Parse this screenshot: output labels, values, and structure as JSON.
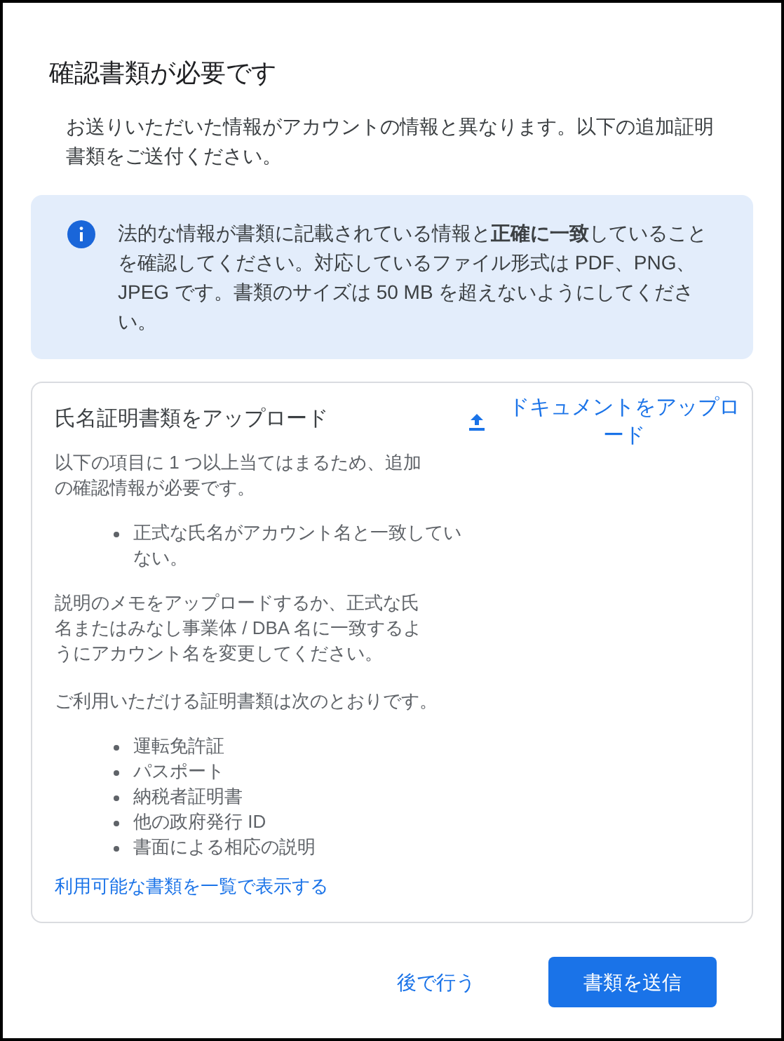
{
  "dialog": {
    "title": "確認書類が必要です",
    "intro": "お送りいただいた情報がアカウントの情報と異なります。以下の追加証明書類をご送付ください。"
  },
  "notice": {
    "text": "法的な情報が書類に記載されている情報と**正確に一致**していることを確認してください。対応しているファイル形式は PDF、PNG、JPEG です。書類のサイズは 50 MB を超えないようにしてください。"
  },
  "upload_card": {
    "title": "氏名証明書類をアップロード",
    "upload_link": "ドキュメントをアップロード",
    "reason": "以下の項目に 1 つ以上当てはまるため、追加の確認情報が必要です。",
    "reasons": [
      "正式な氏名がアカウント名と一致していない。"
    ],
    "instruction": "説明のメモをアップロードするか、正式な氏名またはみなし事業体 / DBA 名に一致するようにアカウント名を変更してください。",
    "accepted_heading": "ご利用いただける証明書類は次のとおりです。",
    "accepted_documents": [
      "運転免許証",
      "パスポート",
      "納税者証明書",
      "他の政府発行 ID",
      "書面による相応の説明"
    ],
    "list_link": "利用可能な書類を一覧で表示する"
  },
  "buttons": [
    {
      "label": "後で行う",
      "kind": "text"
    },
    {
      "label": "書類を送信",
      "kind": "filled"
    }
  ]
}
